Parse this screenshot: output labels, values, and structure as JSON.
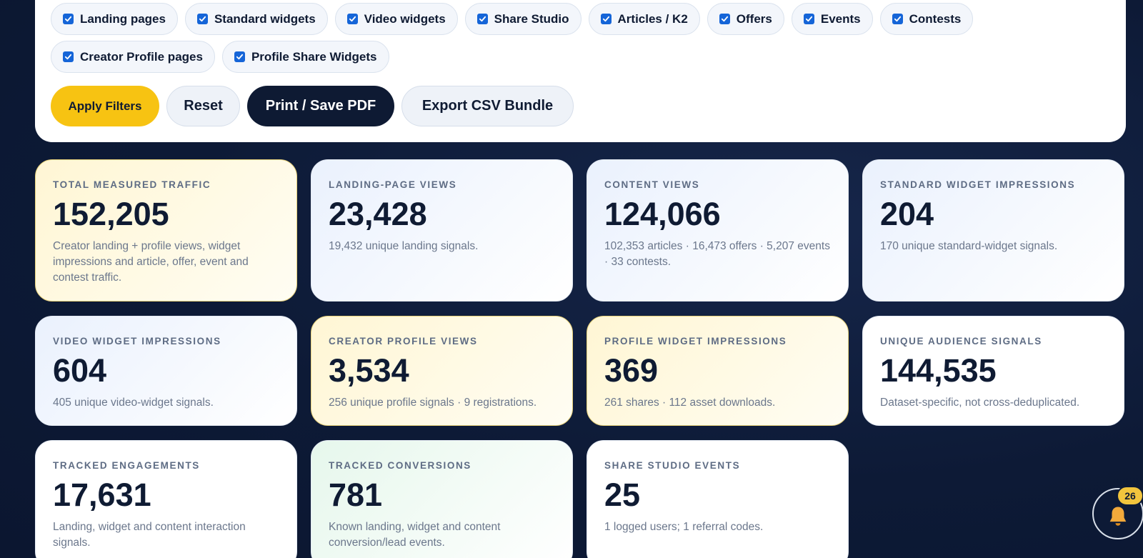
{
  "filters": {
    "chips": [
      {
        "label": "Landing pages",
        "checked": true
      },
      {
        "label": "Standard widgets",
        "checked": true
      },
      {
        "label": "Video widgets",
        "checked": true
      },
      {
        "label": "Share Studio",
        "checked": true
      },
      {
        "label": "Articles / K2",
        "checked": true
      },
      {
        "label": "Offers",
        "checked": true
      },
      {
        "label": "Events",
        "checked": true
      },
      {
        "label": "Contests",
        "checked": true
      },
      {
        "label": "Creator Profile pages",
        "checked": true
      },
      {
        "label": "Profile Share Widgets",
        "checked": true
      }
    ],
    "buttons": {
      "apply": "Apply Filters",
      "reset": "Reset",
      "print": "Print / Save PDF",
      "export": "Export CSV Bundle"
    }
  },
  "cards": [
    {
      "label": "TOTAL MEASURED TRAFFIC",
      "value": "152,205",
      "desc": "Creator landing + profile views, widget impressions and article, offer, event and contest traffic."
    },
    {
      "label": "LANDING-PAGE VIEWS",
      "value": "23,428",
      "desc": "19,432 unique landing signals."
    },
    {
      "label": "CONTENT VIEWS",
      "value": "124,066",
      "desc": "102,353 articles · 16,473 offers · 5,207 events · 33 contests."
    },
    {
      "label": "STANDARD WIDGET IMPRESSIONS",
      "value": "204",
      "desc": "170 unique standard-widget signals."
    },
    {
      "label": "VIDEO WIDGET IMPRESSIONS",
      "value": "604",
      "desc": "405 unique video-widget signals."
    },
    {
      "label": "CREATOR PROFILE VIEWS",
      "value": "3,534",
      "desc": "256 unique profile signals · 9 registrations."
    },
    {
      "label": "PROFILE WIDGET IMPRESSIONS",
      "value": "369",
      "desc": "261 shares · 112 asset downloads."
    },
    {
      "label": "UNIQUE AUDIENCE SIGNALS",
      "value": "144,535",
      "desc": "Dataset-specific, not cross-deduplicated."
    },
    {
      "label": "TRACKED ENGAGEMENTS",
      "value": "17,631",
      "desc": "Landing, widget and content interaction signals."
    },
    {
      "label": "TRACKED CONVERSIONS",
      "value": "781",
      "desc": "Known landing, widget and content conversion/lead events."
    },
    {
      "label": "SHARE STUDIO EVENTS",
      "value": "25",
      "desc": "1 logged users; 1 referral codes."
    }
  ],
  "notifications": {
    "count": "26",
    "icon": "bell-icon"
  },
  "colors": {
    "accent": "#f7c312",
    "dark": "#0e1a33",
    "checkbox": "#1565d8"
  }
}
